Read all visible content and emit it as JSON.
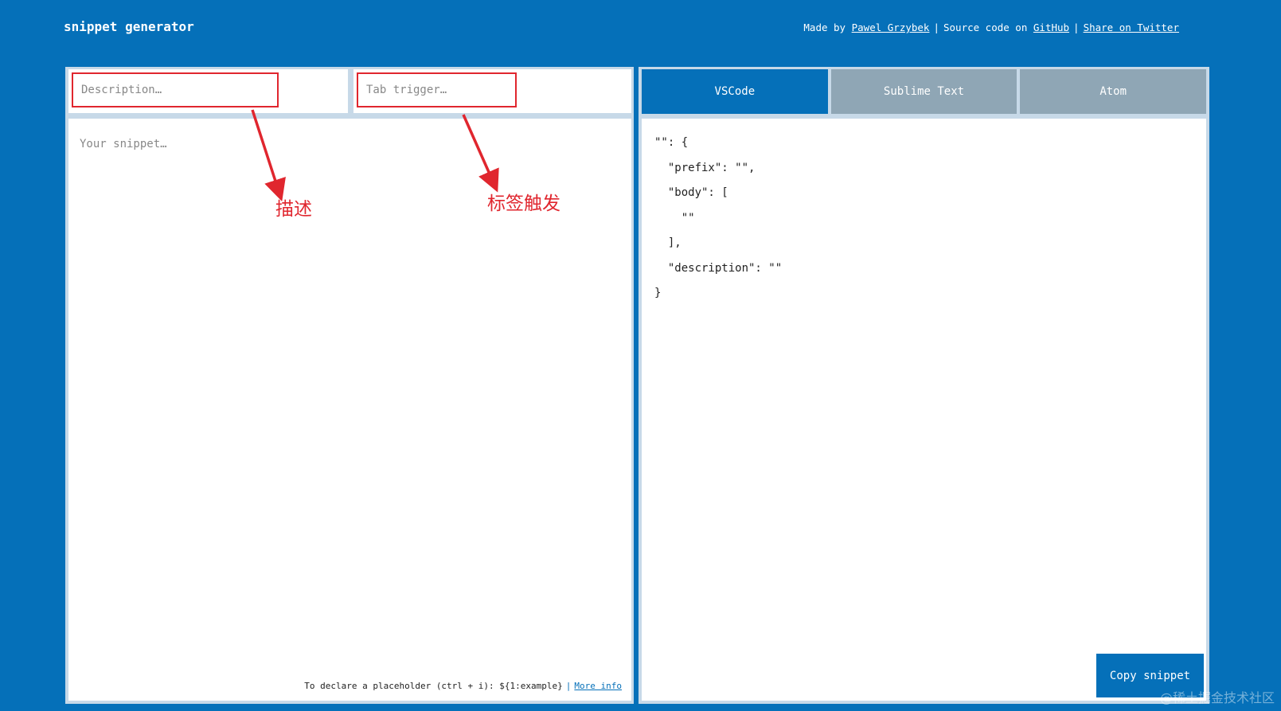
{
  "header": {
    "brand": "snippet generator",
    "made_by_prefix": "Made by ",
    "author": "Pawel Grzybek",
    "source_prefix": "Source code on ",
    "github": "GitHub",
    "share": "Share on Twitter",
    "separator": "|"
  },
  "editor": {
    "description_placeholder": "Description…",
    "tab_trigger_placeholder": "Tab trigger…",
    "snippet_placeholder": "Your snippet…",
    "hint_text": "To declare a placeholder (ctrl + i): ${1:example}",
    "hint_separator": "|",
    "more_info": "More info"
  },
  "tabs": [
    {
      "label": "VSCode",
      "active": true
    },
    {
      "label": "Sublime Text",
      "active": false
    },
    {
      "label": "Atom",
      "active": false
    }
  ],
  "output": {
    "code": "\"\": {\n  \"prefix\": \"\",\n  \"body\": [\n    \"\"\n  ],\n  \"description\": \"\"\n}"
  },
  "copy_button": "Copy snippet",
  "annotations": {
    "description_label": "描述",
    "tab_trigger_label": "标签触发",
    "color": "#e0262e"
  },
  "watermark": "@稀土掘金技术社区",
  "colors": {
    "background": "#0570b9",
    "active_tab": "#0570b9",
    "inactive_tab": "#8fa6b5"
  }
}
